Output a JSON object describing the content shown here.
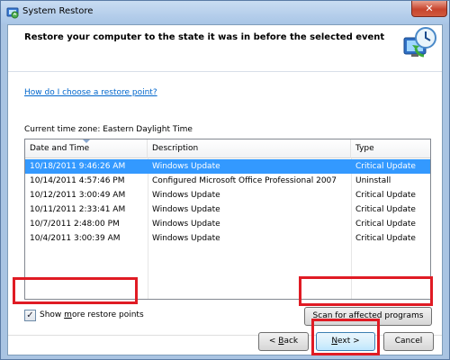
{
  "window": {
    "title": "System Restore",
    "close_glyph": "✕"
  },
  "header": {
    "heading": "Restore your computer to the state it was in before the selected event"
  },
  "help_link": "How do I choose a restore point?",
  "timezone": "Current time zone: Eastern Daylight Time",
  "table": {
    "columns": [
      "Date and Time",
      "Description",
      "Type"
    ],
    "rows": [
      {
        "date": "10/18/2011 9:46:26 AM",
        "description": "Windows Update",
        "type": "Critical Update",
        "selected": true
      },
      {
        "date": "10/14/2011 4:57:46 PM",
        "description": "Configured Microsoft Office Professional 2007",
        "type": "Uninstall",
        "selected": false
      },
      {
        "date": "10/12/2011 3:00:49 AM",
        "description": "Windows Update",
        "type": "Critical Update",
        "selected": false
      },
      {
        "date": "10/11/2011 2:33:41 AM",
        "description": "Windows Update",
        "type": "Critical Update",
        "selected": false
      },
      {
        "date": "10/7/2011 2:48:00 PM",
        "description": "Windows Update",
        "type": "Critical Update",
        "selected": false
      },
      {
        "date": "10/4/2011 3:00:39 AM",
        "description": "Windows Update",
        "type": "Critical Update",
        "selected": false
      }
    ]
  },
  "show_more": {
    "label_pre": "Show ",
    "label_accel": "m",
    "label_post": "ore restore points",
    "checked": true,
    "check_glyph": "✓"
  },
  "buttons": {
    "scan_pre": "Scan for ",
    "scan_accel": "a",
    "scan_post": "ffected programs",
    "back_pre": "< ",
    "back_accel": "B",
    "back_post": "ack",
    "next_pre": "",
    "next_accel": "N",
    "next_post": "ext >",
    "cancel": "Cancel"
  },
  "colors": {
    "selection": "#3399ff",
    "highlight_box": "#e01b24",
    "link": "#0066cc"
  },
  "icons": {
    "title": "system-restore-icon",
    "hero": "system-restore-clock-icon"
  }
}
